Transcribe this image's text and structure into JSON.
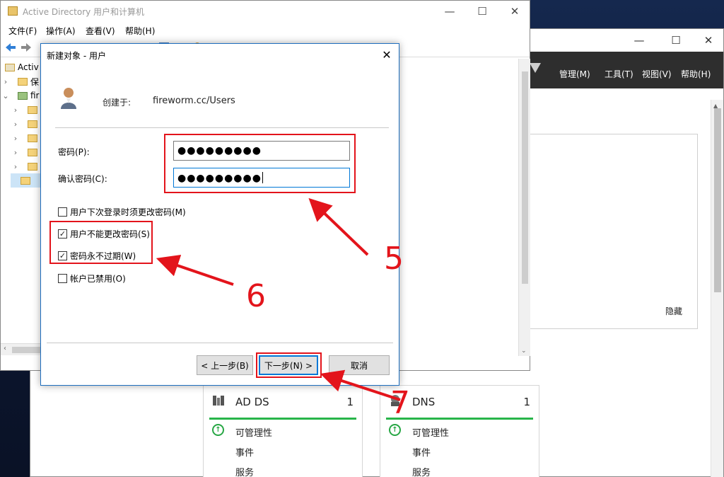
{
  "server_manager": {
    "menu": [
      "管理(M)",
      "工具(T)",
      "视图(V)",
      "帮助(H)"
    ],
    "hide_label": "隐藏",
    "tiles": [
      {
        "title": "AD DS",
        "count": "1",
        "status": "可管理性",
        "items": [
          "事件",
          "服务"
        ]
      },
      {
        "title": "DNS",
        "count": "1",
        "status": "可管理性",
        "items": [
          "事件",
          "服务"
        ]
      }
    ]
  },
  "aduc": {
    "title": "Active Directory 用户和计算机",
    "menu": [
      "文件(F)",
      "操作(A)",
      "查看(V)",
      "帮助(H)"
    ],
    "tree": [
      "Activ",
      "保",
      "fir"
    ]
  },
  "dialog": {
    "title": "新建对象 - 用户",
    "created_in_label": "创建于:",
    "created_in_value": "fireworm.cc/Users",
    "password_label": "密码(P):",
    "password_value": "●●●●●●●●●",
    "confirm_label": "确认密码(C):",
    "confirm_value": "●●●●●●●●●",
    "checkboxes": [
      {
        "label": "用户下次登录时须更改密码(M)",
        "checked": false
      },
      {
        "label": "用户不能更改密码(S)",
        "checked": true
      },
      {
        "label": "密码永不过期(W)",
        "checked": true
      },
      {
        "label": "帐户已禁用(O)",
        "checked": false
      }
    ],
    "back_label": "< 上一步(B)",
    "next_label": "下一步(N) >",
    "cancel_label": "取消"
  },
  "annotations": {
    "n5": "5",
    "n6": "6",
    "n7": "7"
  },
  "colors": {
    "annotation": "#e3141b",
    "accent": "#0078d7",
    "ok": "#28b54a"
  }
}
